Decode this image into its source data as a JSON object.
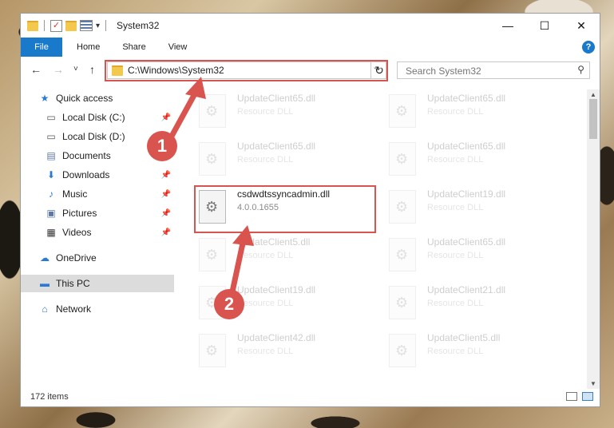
{
  "window": {
    "title": "System32"
  },
  "titlebar": {
    "minimize": "—",
    "maximize": "☐",
    "close": "✕"
  },
  "ribbon": {
    "file": "File",
    "tabs": [
      "Home",
      "Share",
      "View"
    ],
    "help": "?"
  },
  "nav": {
    "back": "←",
    "forward": "→",
    "recent": "˅",
    "up": "↑",
    "address": "C:\\Windows\\System32",
    "refresh": "↻",
    "search_placeholder": "Search System32"
  },
  "sidebar": {
    "items": [
      {
        "label": "Quick access",
        "icon": "★",
        "icon_name": "star-icon"
      },
      {
        "label": "Local Disk (C:)",
        "icon": "▭",
        "icon_name": "drive-icon"
      },
      {
        "label": "Local Disk (D:)",
        "icon": "▭",
        "icon_name": "drive-icon"
      },
      {
        "label": "Documents",
        "icon": "▤",
        "icon_name": "documents-icon"
      },
      {
        "label": "Downloads",
        "icon": "⬇",
        "icon_name": "download-icon"
      },
      {
        "label": "Music",
        "icon": "♪",
        "icon_name": "music-icon"
      },
      {
        "label": "Pictures",
        "icon": "▣",
        "icon_name": "pictures-icon"
      },
      {
        "label": "Videos",
        "icon": "▦",
        "icon_name": "videos-icon"
      },
      {
        "label": "OneDrive",
        "icon": "☁",
        "icon_name": "cloud-icon"
      },
      {
        "label": "This PC",
        "icon": "▬",
        "icon_name": "computer-icon"
      },
      {
        "label": "Network",
        "icon": "⌂",
        "icon_name": "network-icon"
      }
    ],
    "pin": "📌"
  },
  "files": [
    {
      "name": "UpdateClient65.dll",
      "sub": "Resource DLL"
    },
    {
      "name": "UpdateClient65.dll",
      "sub": "Resource DLL"
    },
    {
      "name": "UpdateClient65.dll",
      "sub": "Resource DLL"
    },
    {
      "name": "UpdateClient65.dll",
      "sub": "Resource DLL"
    },
    {
      "name": "csdwdtssyncadmin.dll",
      "sub": "4.0.0.1655"
    },
    {
      "name": "UpdateClient19.dll",
      "sub": "Resource DLL"
    },
    {
      "name": "UpdateClient5.dll",
      "sub": "Resource DLL"
    },
    {
      "name": "UpdateClient65.dll",
      "sub": "Resource DLL"
    },
    {
      "name": "UpdateClient19.dll",
      "sub": "Resource DLL"
    },
    {
      "name": "UpdateClient21.dll",
      "sub": "Resource DLL"
    },
    {
      "name": "UpdateClient42.dll",
      "sub": "Resource DLL"
    },
    {
      "name": "UpdateClient5.dll",
      "sub": "Resource DLL"
    }
  ],
  "status": {
    "count": "172 items"
  },
  "callouts": {
    "one": "1",
    "two": "2"
  },
  "colors": {
    "accent": "#1979ca",
    "highlight": "#d9534f"
  }
}
